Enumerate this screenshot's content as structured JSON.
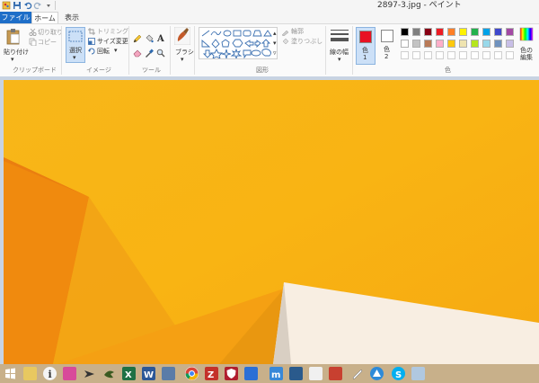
{
  "window": {
    "title": "2897-3.jpg - ペイント"
  },
  "tabs": {
    "file": "ファイル",
    "home": "ホーム",
    "view": "表示"
  },
  "clipboard": {
    "paste": "貼り付け",
    "cut": "切り取り",
    "copy": "コピー",
    "label": "クリップボード"
  },
  "image": {
    "select": "選択",
    "crop": "トリミング",
    "resize": "サイズ変更",
    "rotate": "回転",
    "label": "イメージ"
  },
  "tools": {
    "label": "ツール"
  },
  "brush": {
    "label": "ブラシ"
  },
  "shapes": {
    "outline": "輪郭",
    "fill": "塗りつぶし",
    "label": "図形"
  },
  "line_width": {
    "label": "線の幅"
  },
  "colors": {
    "color1": "色\n1",
    "color1_label": "色",
    "color1_num": "1",
    "color2_label": "色",
    "color2_num": "2",
    "edit": "色の編集",
    "label": "色",
    "selected_color1": "#e81123",
    "selected_color2": "#ffffff",
    "palette_row1": [
      "#000000",
      "#7f7f7f",
      "#880015",
      "#ed1c24",
      "#ff7f27",
      "#fff200",
      "#22b14c",
      "#00a2e8",
      "#3f48cc",
      "#a349a4"
    ],
    "palette_row2": [
      "#ffffff",
      "#c3c3c3",
      "#b97a57",
      "#ffaec9",
      "#ffc90e",
      "#efe4b0",
      "#b5e61d",
      "#99d9ea",
      "#7092be",
      "#c8bfe7"
    ]
  }
}
